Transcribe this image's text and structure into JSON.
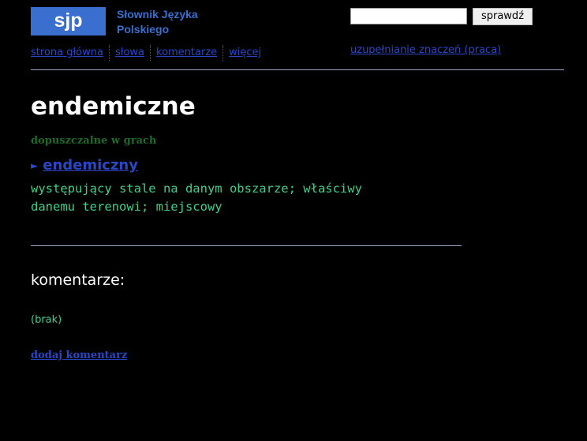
{
  "header": {
    "logo_abbr": "sjp",
    "logo_title_line1": "Słownik Języka",
    "logo_title_line2": "Polskiego",
    "nav": [
      {
        "label": "strona główna"
      },
      {
        "label": "słowa"
      },
      {
        "label": "komentarze"
      },
      {
        "label": "więcej"
      }
    ],
    "search": {
      "value": "",
      "placeholder": "",
      "button_label": "sprawdź"
    },
    "work_link": "uzupełnianie znaczeń (praca)"
  },
  "entry": {
    "title": "endemiczne",
    "game_status": "dopuszczalne w grach",
    "lemma_arrow": "►",
    "lemma": "endemiczny",
    "definition": "występujący stale na danym obszarze; właściwy danemu terenowi; miejscowy"
  },
  "comments": {
    "heading": "komentarze:",
    "empty_text": "(brak)",
    "add_link": "dodaj komentarz"
  },
  "colors": {
    "background": "#000000",
    "brand_blue": "#3a6fd0",
    "link_blue": "#2a47c8",
    "definition_green": "#3fd08a",
    "status_green": "#1d6a2c"
  }
}
